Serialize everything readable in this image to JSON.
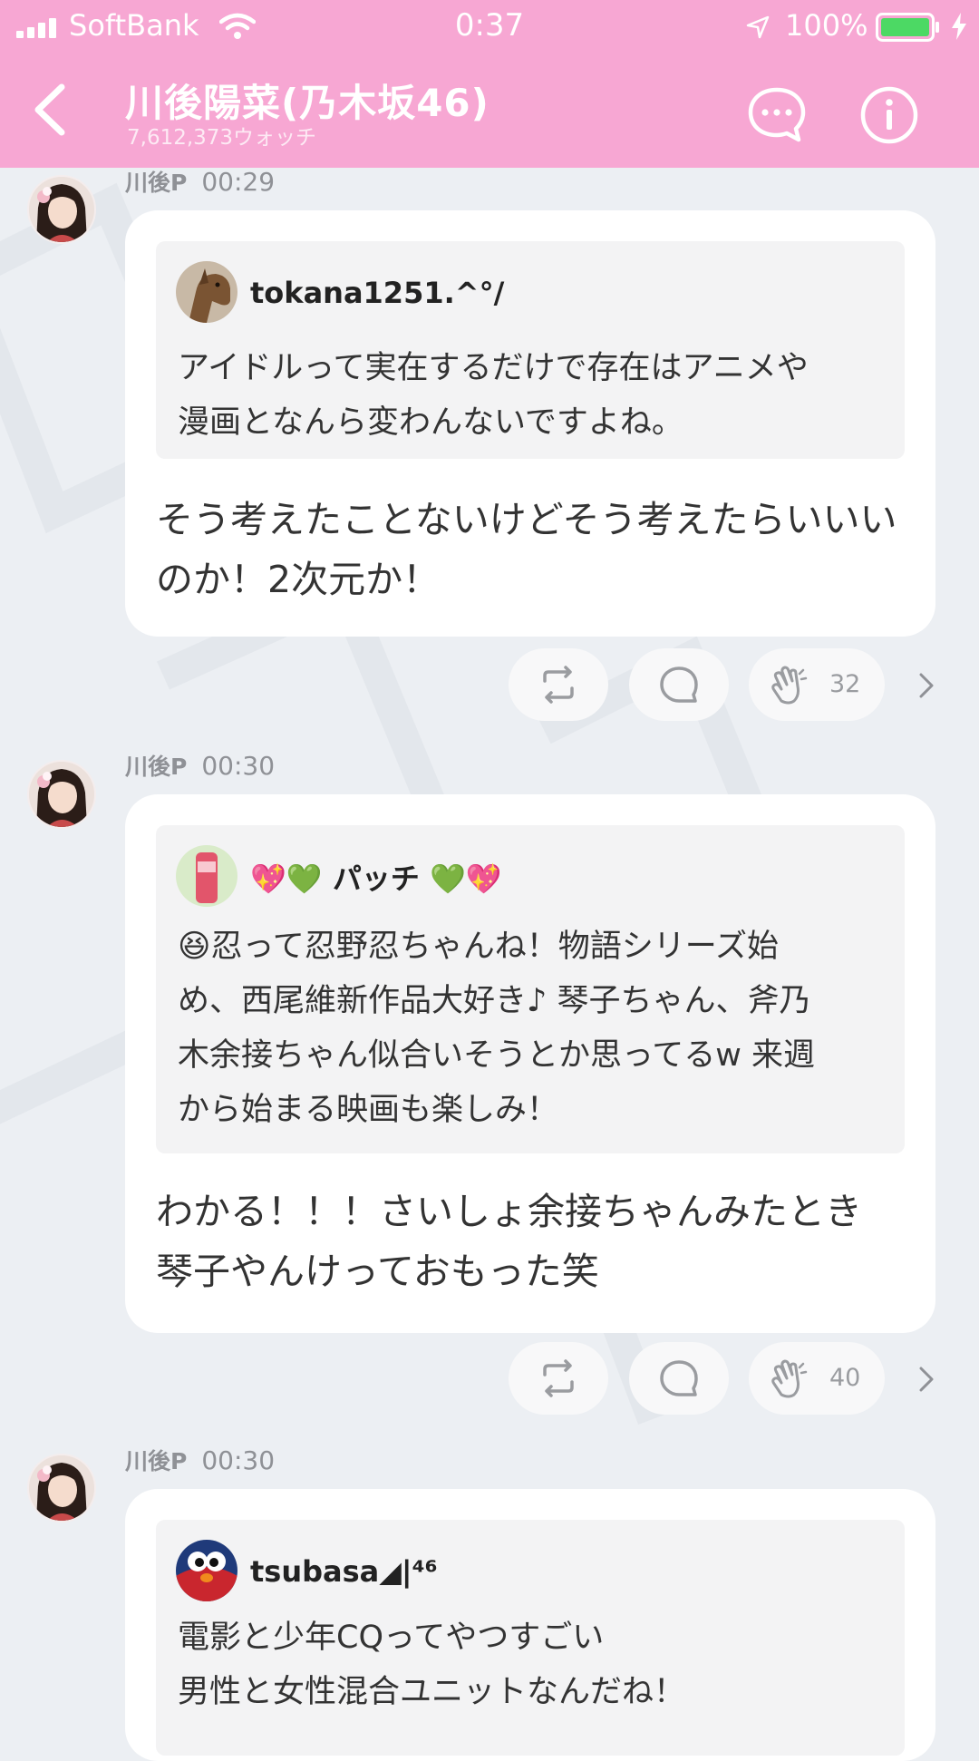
{
  "status_bar": {
    "carrier": "SoftBank",
    "time": "0:37",
    "battery": "100%"
  },
  "header": {
    "title": "川後陽菜(乃木坂46)",
    "subtitle": "7,612,373ウォッチ",
    "colors": {
      "header_bg": "#f7a7d3"
    }
  },
  "messages": [
    {
      "author": "川後P",
      "time": "00:29",
      "quote_user": "tokana1251.^°/",
      "quote_lines": [
        "アイドルって実在するだけで存在はアニメや",
        "漫画となんら変わんないですよね。"
      ],
      "reply_lines": [
        "そう考えたことないけどそう考えたらいいい",
        "のか！2次元か！"
      ],
      "claps": "32"
    },
    {
      "author": "川後P",
      "time": "00:30",
      "quote_user_emoji_left": "💖💚",
      "quote_user": "パッチ",
      "quote_user_emoji_right": "💚💖",
      "quote_lines": [
        "😆忍って忍野忍ちゃんね！物語シリーズ始",
        "め、西尾維新作品大好き♪ 琴子ちゃん、斧乃",
        "木余接ちゃん似合いそうとか思ってるw 来週",
        "から始まる映画も楽しみ！"
      ],
      "reply_lines": [
        "わかる！！！さいしょ余接ちゃんみたとき",
        "琴子やんけっておもった笑"
      ],
      "claps": "40"
    },
    {
      "author": "川後P",
      "time": "00:30",
      "quote_user": "tsubasa◢|⁴⁶",
      "quote_lines": [
        "電影と少年CQってやつすごい",
        "男性と女性混合ユニットなんだね！"
      ]
    }
  ]
}
